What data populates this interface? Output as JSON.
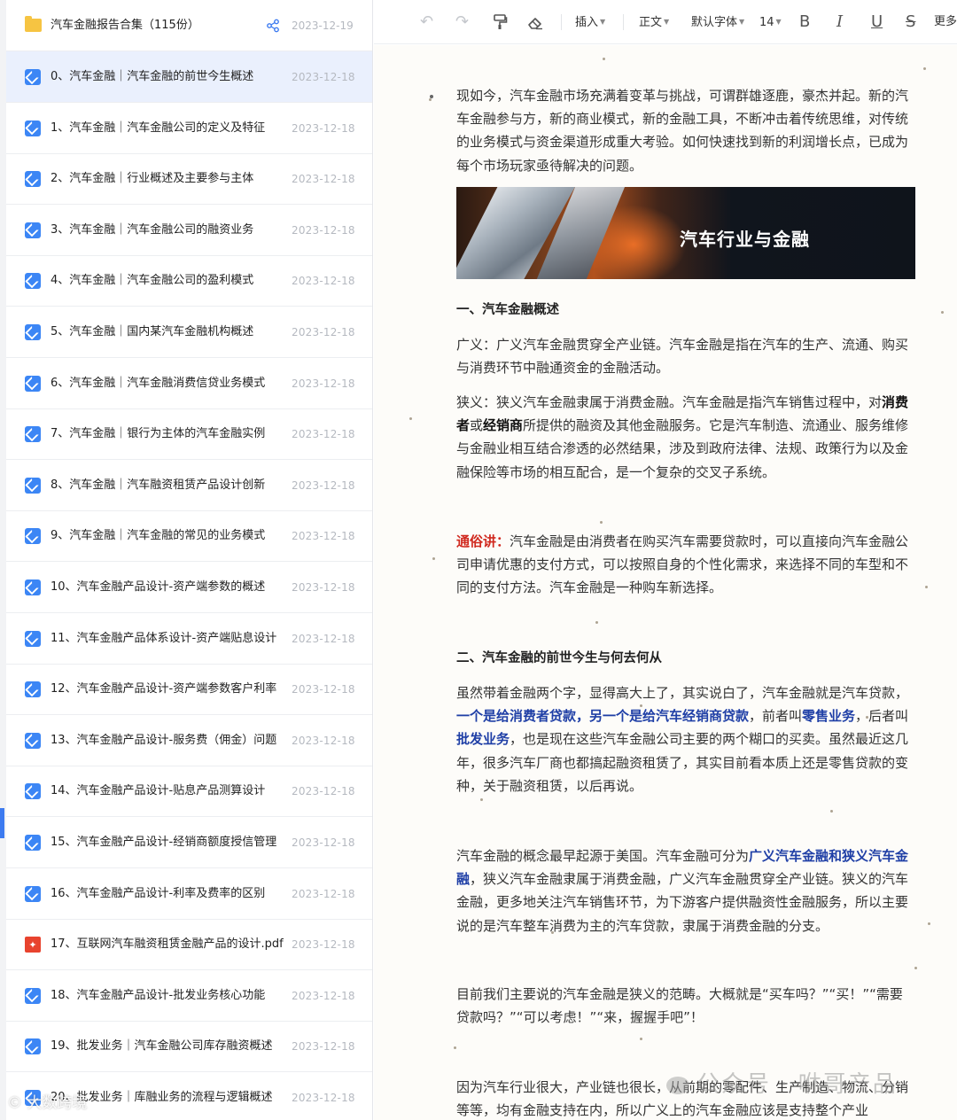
{
  "sidebar": {
    "folder": {
      "name": "汽车金融报告合集（115份）",
      "date": "2023-12-19",
      "share_icon": "share-icon"
    },
    "files": [
      {
        "title": "0、汽车金融｜汽车金融的前世今生概述",
        "date": "2023-12-18",
        "type": "doc",
        "active": true
      },
      {
        "title": "1、汽车金融｜汽车金融公司的定义及特征",
        "date": "2023-12-18",
        "type": "doc"
      },
      {
        "title": "2、汽车金融｜行业概述及主要参与主体",
        "date": "2023-12-18",
        "type": "doc"
      },
      {
        "title": "3、汽车金融｜汽车金融公司的融资业务",
        "date": "2023-12-18",
        "type": "doc"
      },
      {
        "title": "4、汽车金融｜汽车金融公司的盈利模式",
        "date": "2023-12-18",
        "type": "doc"
      },
      {
        "title": "5、汽车金融｜国内某汽车金融机构概述",
        "date": "2023-12-18",
        "type": "doc"
      },
      {
        "title": "6、汽车金融｜汽车金融消费信贷业务模式",
        "date": "2023-12-18",
        "type": "doc"
      },
      {
        "title": "7、汽车金融｜银行为主体的汽车金融实例",
        "date": "2023-12-18",
        "type": "doc"
      },
      {
        "title": "8、汽车金融｜汽车融资租赁产品设计创新",
        "date": "2023-12-18",
        "type": "doc"
      },
      {
        "title": "9、汽车金融｜汽车金融的常见的业务模式",
        "date": "2023-12-18",
        "type": "doc"
      },
      {
        "title": "10、汽车金融产品设计-资产端参数的概述",
        "date": "2023-12-18",
        "type": "doc"
      },
      {
        "title": "11、汽车金融产品体系设计-资产端贴息设计",
        "date": "2023-12-18",
        "type": "doc"
      },
      {
        "title": "12、汽车金融产品设计-资产端参数客户利率",
        "date": "2023-12-18",
        "type": "doc"
      },
      {
        "title": "13、汽车金融产品设计-服务费（佣金）问题",
        "date": "2023-12-18",
        "type": "doc"
      },
      {
        "title": "14、汽车金融产品设计-贴息产品测算设计",
        "date": "2023-12-18",
        "type": "doc"
      },
      {
        "title": "15、汽车金融产品设计-经销商额度授信管理",
        "date": "2023-12-18",
        "type": "doc"
      },
      {
        "title": "16、汽车金融产品设计-利率及费率的区别",
        "date": "2023-12-18",
        "type": "doc"
      },
      {
        "title": "17、互联网汽车融资租赁金融产品的设计.pdf",
        "date": "2023-12-18",
        "type": "pdf"
      },
      {
        "title": "18、汽车金融产品设计-批发业务核心功能",
        "date": "2023-12-18",
        "type": "doc"
      },
      {
        "title": "19、批发业务｜汽车金融公司库存融资概述",
        "date": "2023-12-18",
        "type": "doc"
      },
      {
        "title": "20、批发业务｜库融业务的流程与逻辑概述",
        "date": "2023-12-18",
        "type": "doc"
      }
    ],
    "watermark": "© 大数跨境"
  },
  "toolbar": {
    "undo_icon": "undo-icon",
    "redo_icon": "redo-icon",
    "format_painter_icon": "format-painter-icon",
    "eraser_icon": "eraser-icon",
    "insert": "插入",
    "style": "正文",
    "font": "默认字体",
    "size": "14",
    "bold": "B",
    "italic": "I",
    "underline": "U",
    "strike": "S",
    "more": "更多"
  },
  "doc": {
    "intro": "现如今，汽车金融市场充满着变革与挑战，可谓群雄逐鹿，豪杰并起。新的汽车金融参与方，新的商业模式，新的金融工具，不断冲击着传统思维，对传统的业务模式与资金渠道形成重大考验。如何快速找到新的利润增长点，已成为每个市场玩家亟待解决的问题。",
    "banner_title": "汽车行业与金融",
    "h1": "一、汽车金融概述",
    "broad": "广义：广义汽车金融贯穿全产业链。汽车金融是指在汽车的生产、流通、购买与消费环节中融通资金的金融活动。",
    "narrow_a": "狭义：狭义汽车金融隶属于消费金融。汽车金融是指汽车销售过程中，对",
    "narrow_b1": "消费者",
    "narrow_c": "或",
    "narrow_b2": "经销商",
    "narrow_d": "所提供的融资及其他金融服务。它是汽车制造、流通业、服务维修与金融业相互结合渗透的必然结果，涉及到政府法律、法规、政策行为以及金融保险等市场的相互配合，是一个复杂的交叉子系统。",
    "plain_label": "通俗讲：",
    "plain_text": "汽车金融是由消费者在购买汽车需要贷款时，可以直接向汽车金融公司申请优惠的支付方式，可以按照自身的个性化需求，来选择不同的车型和不同的支付方法。汽车金融是一种购车新选择。",
    "h2": "二、汽车金融的前世今生与何去何从",
    "p2_a": "虽然带着金融两个字，显得高大上了，其实说白了，汽车金融就是汽车贷款，",
    "p2_b": "一个是给消费者贷款，另一个是给汽车经销商贷款",
    "p2_c": "，前者叫",
    "p2_d": "零售业务",
    "p2_e": "，后者叫",
    "p2_f": "批发业务",
    "p2_g": "，也是现在这些汽车金融公司主要的两个糊口的买卖。虽然最近这几年，很多汽车厂商也都搞起融资租赁了，其实目前看本质上还是零售贷款的变种，关于融资租赁，以后再说。",
    "p3_a": "汽车金融的概念最早起源于美国。汽车金融可分为",
    "p3_b": "广义汽车金融和狭义汽车金融",
    "p3_c": "，狭义汽车金融隶属于消费金融，广义汽车金融贯穿全产业链。狭义的汽车金融，更多地关注汽车销售环节，为下游客户提供融资性金融服务，所以主要说的是汽车整车消费为主的汽车贷款，隶属于消费金融的分支。",
    "p4": "目前我们主要说的汽车金融是狭义的范畴。大概就是“买车吗？”“买！”“需要贷款吗？”“可以考虑！”“来，握握手吧”！",
    "p5": "因为汽车行业很大，产业链也很长，从前期的零配件、生产制造、物流、分销等等，均有金融支持在内，所以广义上的汽车金融应该是支持整个产业",
    "watermark": "公众号 · 咻哥产品"
  }
}
